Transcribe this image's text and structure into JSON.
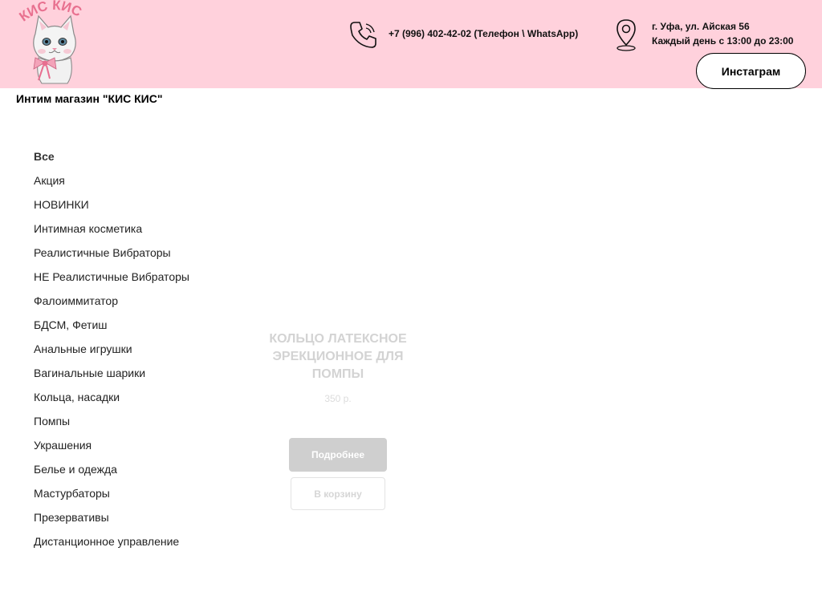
{
  "header": {
    "logo_text": "КИС КИС",
    "phone": "+7 (996) 402-42-02 (Телефон \\ WhatsApp)",
    "address": "г. Уфа, ул. Айская 56",
    "hours": "Каждый день с 13:00 до 23:00",
    "instagram_button": "Инстаграм",
    "background_color": "#ffd1dc"
  },
  "store_title": "Интим магазин \"КИС КИС\"",
  "categories": [
    "Все",
    "Акция",
    "НОВИНКИ",
    "Интимная косметика",
    "Реалистичные Вибраторы",
    "НЕ Реалистичные Вибраторы",
    "Фалоиммитатор",
    "БДСМ, Фетиш",
    "Анальные игрушки",
    "Вагинальные шарики",
    "Кольца, насадки",
    "Помпы",
    "Украшения",
    "Белье и одежда",
    "Мастурбаторы",
    "Презервативы",
    "Дистанционное управление"
  ],
  "active_category": "Все",
  "product": {
    "title": "Кольцо латексное эрекционное для помпы",
    "price": "350 р.",
    "details_button": "Подробнее",
    "cart_button": "В корзину"
  },
  "icons": {
    "phone": "phone-icon",
    "location": "location-pin-icon",
    "logo": "cat-logo"
  }
}
